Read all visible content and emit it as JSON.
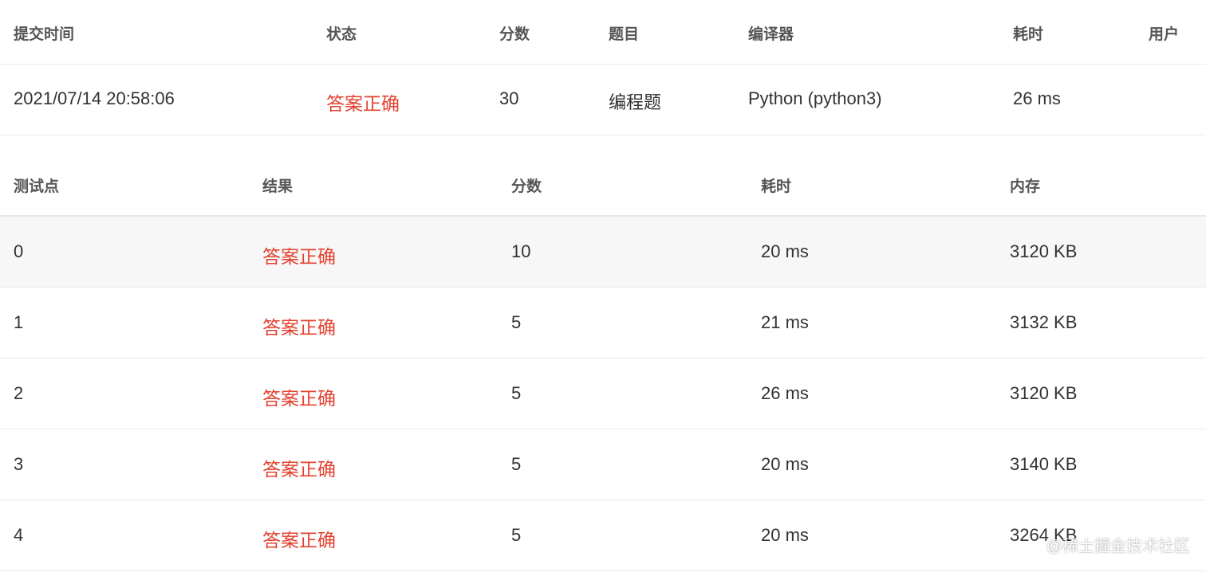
{
  "submission": {
    "headers": {
      "time": "提交时间",
      "status": "状态",
      "score": "分数",
      "problem": "题目",
      "compiler": "编译器",
      "duration": "耗时",
      "user": "用户"
    },
    "row": {
      "time": "2021/07/14 20:58:06",
      "status": "答案正确",
      "score": "30",
      "problem": "编程题",
      "compiler": "Python (python3)",
      "duration": "26 ms",
      "user": ""
    }
  },
  "testcases": {
    "headers": {
      "case": "测试点",
      "result": "结果",
      "score": "分数",
      "time": "耗时",
      "memory": "内存"
    },
    "rows": [
      {
        "case": "0",
        "result": "答案正确",
        "score": "10",
        "time": "20 ms",
        "memory": "3120 KB"
      },
      {
        "case": "1",
        "result": "答案正确",
        "score": "5",
        "time": "21 ms",
        "memory": "3132 KB"
      },
      {
        "case": "2",
        "result": "答案正确",
        "score": "5",
        "time": "26 ms",
        "memory": "3120 KB"
      },
      {
        "case": "3",
        "result": "答案正确",
        "score": "5",
        "time": "20 ms",
        "memory": "3140 KB"
      },
      {
        "case": "4",
        "result": "答案正确",
        "score": "5",
        "time": "20 ms",
        "memory": "3264 KB"
      }
    ]
  },
  "watermark": "@稀土掘金技术社区",
  "colors": {
    "accepted": "#e3412f",
    "row_highlight": "#f7f7f7",
    "border": "#ebebeb"
  }
}
